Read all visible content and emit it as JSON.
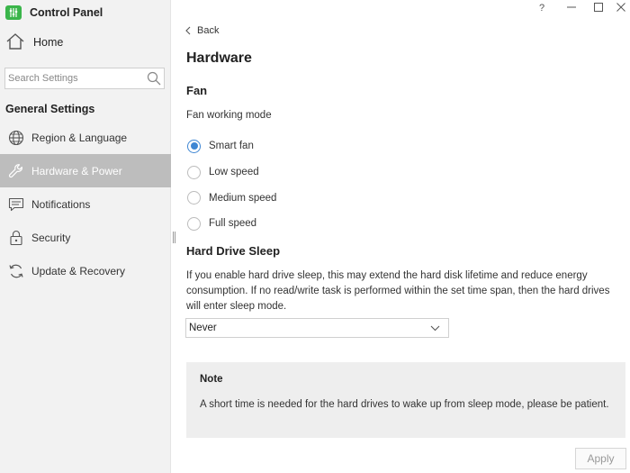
{
  "app": {
    "title": "Control Panel",
    "logo_color": "#3ab54a"
  },
  "sidebar": {
    "home_label": "Home",
    "search_placeholder": "Search Settings",
    "section_heading": "General Settings",
    "items": [
      {
        "label": "Region & Language",
        "icon": "globe-icon",
        "active": false
      },
      {
        "label": "Hardware & Power",
        "icon": "wrench-icon",
        "active": true
      },
      {
        "label": "Notifications",
        "icon": "message-icon",
        "active": false
      },
      {
        "label": "Security",
        "icon": "lock-icon",
        "active": false
      },
      {
        "label": "Update & Recovery",
        "icon": "refresh-icon",
        "active": false
      }
    ]
  },
  "window_controls": {
    "help": "?",
    "minimize": "minimize-icon",
    "maximize": "maximize-icon",
    "close": "close-icon"
  },
  "main": {
    "back_label": "Back",
    "page_title": "Hardware",
    "fan": {
      "heading": "Fan",
      "mode_label": "Fan working mode",
      "options": [
        "Smart fan",
        "Low speed",
        "Medium speed",
        "Full speed"
      ],
      "selected": "Smart fan"
    },
    "sleep": {
      "heading": "Hard Drive Sleep",
      "description": "If you enable hard drive sleep, this may extend the hard disk lifetime and reduce energy consumption. If no read/write task is performed within the set time span, then the hard drives will enter sleep mode.",
      "select_value": "Never"
    },
    "note": {
      "title": "Note",
      "body": "A short time is needed for the hard drives to wake up from sleep mode, please be patient."
    },
    "apply_label": "Apply"
  },
  "colors": {
    "accent": "#3e86d3",
    "active_nav_bg": "#bdbdbd",
    "sidebar_bg": "#f2f2f2",
    "note_bg": "#eeeeee"
  }
}
